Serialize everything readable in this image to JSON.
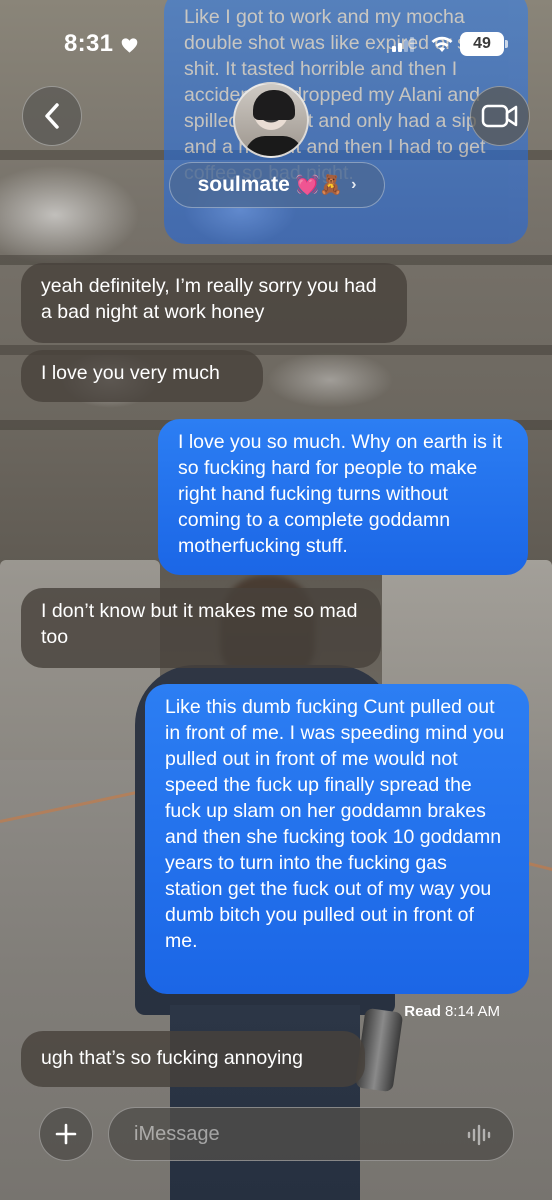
{
  "status_bar": {
    "time": "8:31",
    "battery": "49"
  },
  "header": {
    "contact_name": "soulmate",
    "name_emojis": "💓🧸"
  },
  "messages": [
    {
      "direction": "sent",
      "text": "Like I got to work and my mocha double shot was like expired or some shit. It tasted horrible and then I accidentally dropped my Alani and spilled half of it and only had a sip and a half left and then I had to get coffee so bad night."
    },
    {
      "direction": "received",
      "text": "yeah definitely, I’m really sorry you had a bad night at work honey"
    },
    {
      "direction": "received",
      "text": "I love you very much"
    },
    {
      "direction": "sent",
      "text": "I love you so much. Why on earth is it so fucking hard for people to make right hand fucking turns without coming to a complete goddamn motherfucking stuff."
    },
    {
      "direction": "received",
      "text": "I don’t know but it makes me so mad too"
    },
    {
      "direction": "sent",
      "text": "Like this dumb fucking Cunt pulled out in front of me. I was speeding mind you pulled out in front of me would not speed the fuck up finally spread the fuck up slam on her goddamn brakes and then she fucking took 10 goddamn years to turn into the fucking gas station get the fuck out of my way you dumb bitch you pulled out in front of me."
    },
    {
      "direction": "received",
      "text": "ugh that’s so fucking annoying"
    }
  ],
  "read_receipt": {
    "label": "Read",
    "time": "8:14 AM"
  },
  "composer": {
    "placeholder": "iMessage"
  },
  "colors": {
    "sent_bubble": "#1f72f0",
    "received_bubble": "#48423c"
  },
  "icons": [
    "heart-icon",
    "signal-icon",
    "wifi-icon",
    "back-chevron-icon",
    "video-camera-icon",
    "plus-icon",
    "audio-wave-icon"
  ]
}
